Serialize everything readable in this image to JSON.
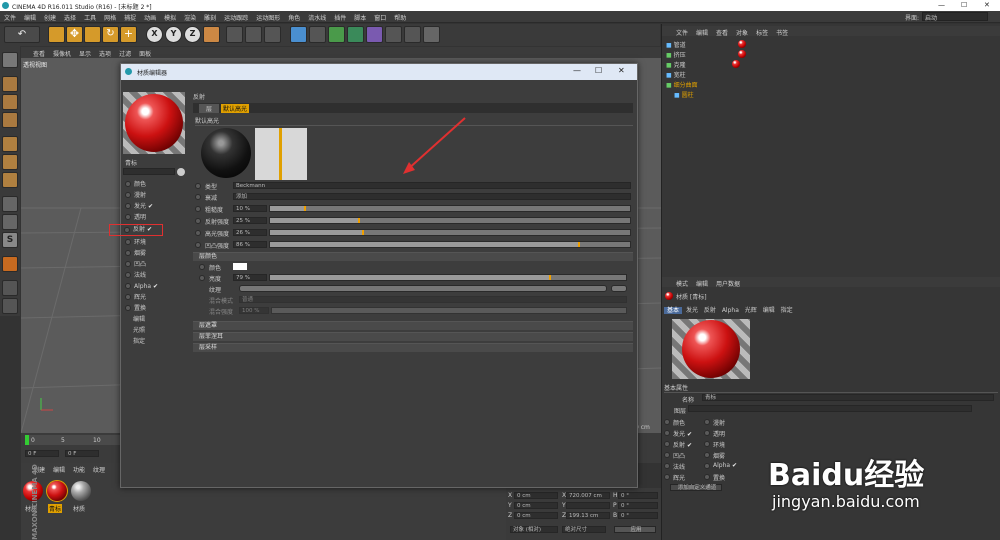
{
  "window": {
    "title": "CINEMA 4D R16.011 Studio (R16) - [未标题 2 *]",
    "controls": [
      "—",
      "☐",
      "✕"
    ]
  },
  "menu": [
    "文件",
    "编辑",
    "创建",
    "选择",
    "工具",
    "网格",
    "捕捉",
    "动画",
    "模拟",
    "渲染",
    "雕刻",
    "运动跟踪",
    "运动图形",
    "角色",
    "流水线",
    "插件",
    "脚本",
    "窗口",
    "帮助"
  ],
  "layout": {
    "label": "界面:",
    "value": "启动"
  },
  "viewport": {
    "menu": [
      "查看",
      "摄像机",
      "显示",
      "选项",
      "过滤",
      "面板"
    ],
    "name": "透视视图"
  },
  "timeline": {
    "ticks": [
      "0",
      "5",
      "10"
    ],
    "frame_start": "0 F",
    "frame_cur": "0 F",
    "mark": "0 cm"
  },
  "material_manager": {
    "menu": [
      "创建",
      "编辑",
      "功能",
      "纹理"
    ],
    "materials": [
      "材质",
      "青标",
      "材质"
    ],
    "brand": "MAXON CINEMA 4D"
  },
  "coords": {
    "rows": [
      {
        "a": "X",
        "av": "0 cm",
        "b": "X",
        "bv": "720.007 cm",
        "c": "H",
        "cv": "0 °"
      },
      {
        "a": "Y",
        "av": "0 cm",
        "b": "Y",
        "bv": "",
        "c": "P",
        "cv": "0 °"
      },
      {
        "a": "Z",
        "av": "0 cm",
        "b": "Z",
        "bv": "199.13 cm",
        "c": "B",
        "cv": "0 °"
      }
    ],
    "mode1": "对象 (相对)",
    "mode2": "绝对尺寸",
    "apply": "应用"
  },
  "objects": {
    "menu": [
      "文件",
      "编辑",
      "查看",
      "对象",
      "标签",
      "书签"
    ],
    "items": [
      "管道",
      "挤压",
      "克隆",
      "宽柱",
      "细分曲面",
      "圆柱"
    ]
  },
  "attributes": {
    "menu": [
      "模式",
      "编辑",
      "用户数据"
    ],
    "title": "材质 [青标]",
    "tabs": [
      "基本",
      "发光",
      "反射",
      "Alpha",
      "光辉",
      "编辑",
      "指定"
    ],
    "section": "基本属性",
    "name_label": "名称",
    "name_value": "青标",
    "layer_label": "图层",
    "channels_left": [
      "颜色",
      "发光",
      "反射",
      "凹凸",
      "法线",
      "辉光"
    ],
    "channels_left_checked": [
      false,
      true,
      true,
      false,
      false,
      false
    ],
    "channels_right": [
      "漫射",
      "透明",
      "环境",
      "烟雾",
      "Alpha",
      "置换"
    ],
    "channels_right_checked": [
      false,
      false,
      false,
      false,
      true,
      false
    ],
    "button": "添加自定义通道"
  },
  "dialog": {
    "title": "材质编辑器",
    "controls": [
      "—",
      "☐",
      "✕"
    ],
    "mat_name": "青标",
    "channels": [
      {
        "label": "颜色",
        "checked": false
      },
      {
        "label": "漫射",
        "checked": false
      },
      {
        "label": "发光",
        "checked": true
      },
      {
        "label": "透明",
        "checked": false
      },
      {
        "label": "反射",
        "checked": true
      },
      {
        "label": "环境",
        "checked": false
      },
      {
        "label": "烟雾",
        "checked": false
      },
      {
        "label": "凹凸",
        "checked": false
      },
      {
        "label": "法线",
        "checked": false
      },
      {
        "label": "Alpha",
        "checked": true
      },
      {
        "label": "辉光",
        "checked": false
      },
      {
        "label": "置换",
        "checked": false
      }
    ],
    "extras": [
      "编辑",
      "光照",
      "指定"
    ],
    "header": "反射",
    "tab_layers": "层",
    "tab_default": "默认高光",
    "layer_name": "默认高光",
    "type_label": "类型",
    "type_value": "Beckmann",
    "atten_label": "衰减",
    "atten_value": "添加",
    "sliders": [
      {
        "label": "粗糙度",
        "value": "10 %",
        "frac": 0.1
      },
      {
        "label": "反射强度",
        "value": "25 %",
        "frac": 0.25
      },
      {
        "label": "高光强度",
        "value": "26 %",
        "frac": 0.26
      },
      {
        "label": "凹凸强度",
        "value": "86 %",
        "frac": 0.86
      }
    ],
    "layer_color": "层颜色",
    "color_label": "颜色",
    "bright_label": "亮度",
    "bright_value": "79 %",
    "bright_frac": 0.79,
    "texture_label": "纹理",
    "mix_mode": "混合模式",
    "mix_value": "普通",
    "mix_strength": "混合强度",
    "mix_strength_value": "100 %",
    "sections": [
      "层遮罩",
      "层菲涅耳",
      "层采样"
    ]
  },
  "watermark": {
    "text": "Baidu经验",
    "url": "jingyan.baidu.com"
  }
}
